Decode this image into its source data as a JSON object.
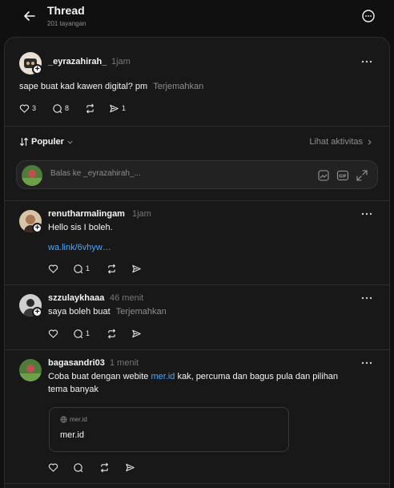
{
  "header": {
    "title": "Thread",
    "views": "201 tayangan"
  },
  "main_post": {
    "username": "_eyrazahirah_",
    "time": "1jam",
    "text": "sape buat kad kawen digital? pm",
    "translate": "Terjemahkan",
    "likes": "3",
    "comments": "8",
    "shares": "1"
  },
  "sort": {
    "label": "Populer",
    "activity": "Lihat aktivitas"
  },
  "reply": {
    "placeholder": "Balas ke _eyrazahirah_..."
  },
  "replies": [
    {
      "username": "renutharmalingam",
      "time": "1jam",
      "text": "Hello sis I boleh.",
      "link": "wa.link/6vhyw…",
      "comments": "1"
    },
    {
      "username": "szzulaykhaaa",
      "time": "46 menit",
      "text": "saya boleh buat",
      "translate": "Terjemahkan",
      "comments": "1"
    },
    {
      "username": "bagasandri03",
      "time": "1 menit",
      "text_before": "Coba buat dengan webite ",
      "text_link": "mer.id",
      "text_after": " kak, percuma dan bagus pula dan pilihan",
      "text_line2": "tema banyak",
      "card_domain": "mer.id",
      "card_title": "mer.id"
    }
  ],
  "icons": [
    "back-arrow-icon",
    "more-circle-icon",
    "heart-icon",
    "comment-icon",
    "repost-icon",
    "share-icon",
    "sort-icon",
    "chevron-down-icon",
    "chevron-right-icon",
    "image-icon",
    "gif-icon",
    "expand-icon",
    "globe-icon",
    "more-dots-icon"
  ],
  "colors": {
    "background": "#101010",
    "panel": "#181818",
    "link": "#4aa8ff",
    "muted": "#8e8e8e"
  }
}
